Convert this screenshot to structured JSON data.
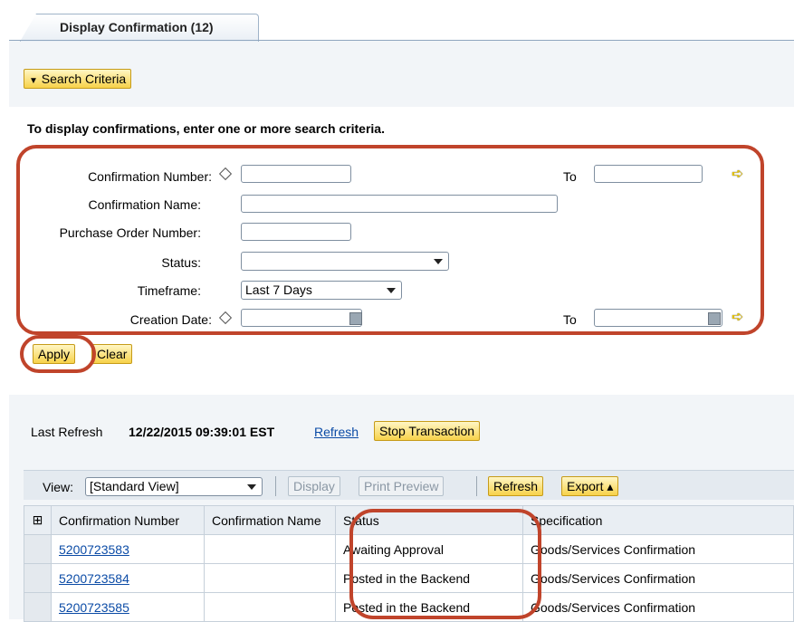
{
  "tab": {
    "label": "Display Confirmation (12)"
  },
  "search_criteria": {
    "toggle_label": "Search Criteria",
    "instruction": "To display confirmations, enter one or more search criteria.",
    "confirmation_number_label": "Confirmation Number:",
    "to_label": "To",
    "confirmation_name_label": "Confirmation Name:",
    "po_number_label": "Purchase Order Number:",
    "status_label": "Status:",
    "status_value": "",
    "timeframe_label": "Timeframe:",
    "timeframe_value": "Last 7 Days",
    "creation_date_label": "Creation Date:",
    "apply_label": "Apply",
    "clear_label": "Clear"
  },
  "refresh_bar": {
    "last_refresh_label": "Last Refresh",
    "timestamp": "12/22/2015 09:39:01 EST",
    "refresh_link": "Refresh",
    "stop_button": "Stop Transaction"
  },
  "table_toolbar": {
    "view_label": "View:",
    "view_value": "[Standard View]",
    "display_button": "Display",
    "print_preview_button": "Print Preview",
    "refresh_button": "Refresh",
    "export_button": "Export ▴"
  },
  "table": {
    "columns": [
      "Confirmation Number",
      "Confirmation Name",
      "Status",
      "Specification"
    ],
    "rows": [
      {
        "number": "5200723583",
        "name": "",
        "status": "Awaiting Approval",
        "spec": "Goods/Services Confirmation"
      },
      {
        "number": "5200723584",
        "name": "",
        "status": "Posted in the Backend",
        "spec": "Goods/Services Confirmation"
      },
      {
        "number": "5200723585",
        "name": "",
        "status": "Posted in the Backend",
        "spec": "Goods/Services Confirmation"
      }
    ]
  },
  "colors": {
    "accent_ring": "#c0442b",
    "button_yellow": "#f7d24a",
    "link": "#0b4ba6"
  },
  "icons": [
    "diamond-icon",
    "calendar-icon",
    "yellow-arrow-icon",
    "dropdown-arrow-icon",
    "table-settings-icon"
  ]
}
